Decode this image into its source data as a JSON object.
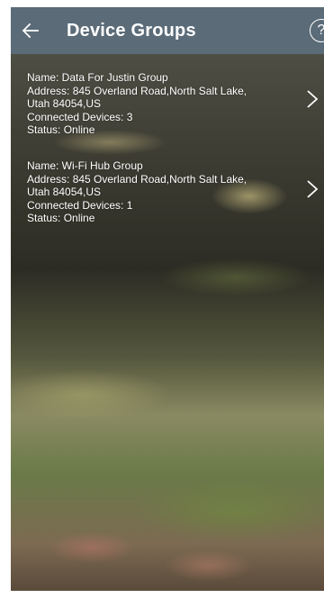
{
  "header": {
    "title": "Device Groups",
    "help_label": "?"
  },
  "groups": [
    {
      "name": "Name: Data For Justin Group",
      "address": "Address: 845 Overland Road,North Salt Lake, Utah 84054,US",
      "connected": "Connected Devices: 3",
      "status": "Status: Online"
    },
    {
      "name": "Name: Wi-Fi Hub Group",
      "address": "Address: 845 Overland Road,North Salt Lake, Utah 84054,US",
      "connected": "Connected Devices: 1",
      "status": "Status: Online"
    }
  ],
  "colors": {
    "app_bar": "#5b6b78",
    "text": "#ffffff"
  },
  "icons": {
    "back": "arrow-left-icon",
    "help": "help-circle-icon",
    "chevron": "chevron-right-icon"
  }
}
